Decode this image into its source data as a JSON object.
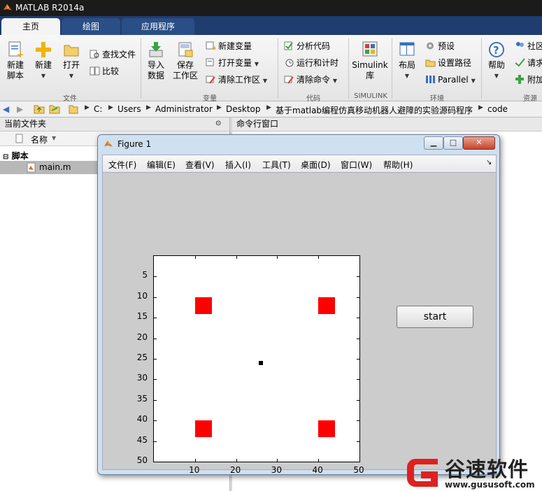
{
  "app": {
    "title": "MATLAB R2014a"
  },
  "tabs": [
    "主页",
    "绘图",
    "应用程序"
  ],
  "ribbon": {
    "file_group": "文件",
    "new_script": [
      "新建",
      "脚本"
    ],
    "new": "新建",
    "open": "打开",
    "find_files": "查找文件",
    "compare": "比较",
    "variable_group": "变量",
    "import_data": [
      "导入",
      "数据"
    ],
    "save_workspace": [
      "保存",
      "工作区"
    ],
    "new_variable": "新建变量",
    "open_variable": "打开变量",
    "clear_workspace": "清除工作区",
    "code_group": "代码",
    "analyze_code": "分析代码",
    "run_and_time": "运行和计时",
    "clear_commands": "清除命令",
    "simulink_group": "SIMULINK",
    "simulink_library": [
      "Simulink",
      "库"
    ],
    "environment_group": "环境",
    "layout": "布局",
    "preferences": "预设",
    "set_path": "设置路径",
    "parallel": "Parallel",
    "resources_group": "资源",
    "help": "帮助",
    "community": "社区",
    "request_support": "请求",
    "addons": "附加"
  },
  "address": [
    "C:",
    "Users",
    "Administrator",
    "Desktop",
    "基于matlab编程仿真移动机器人避障的实验源码程序",
    "code"
  ],
  "current_folder": {
    "title": "当前文件夹",
    "column_name": "名称",
    "group": "脚本",
    "file": "main.m"
  },
  "command_window": {
    "title": "命令行窗口"
  },
  "figure": {
    "title": "Figure 1",
    "menu": [
      "文件(F)",
      "编辑(E)",
      "查看(V)",
      "插入(I)",
      "工具(T)",
      "桌面(D)",
      "窗口(W)",
      "帮助(H)"
    ],
    "start_button": "start"
  },
  "chart_data": {
    "type": "scatter",
    "xlim": [
      0,
      50
    ],
    "ylim": [
      0,
      50
    ],
    "y_reversed": true,
    "xticks": [
      10,
      20,
      30,
      40,
      50
    ],
    "yticks": [
      5,
      10,
      15,
      20,
      25,
      30,
      35,
      40,
      45,
      50
    ],
    "series": [
      {
        "name": "",
        "marker": "square",
        "color": "#ff0000",
        "points": [
          [
            12,
            12
          ],
          [
            42,
            12
          ],
          [
            12,
            42
          ],
          [
            42,
            42
          ]
        ]
      },
      {
        "name": "",
        "marker": "point",
        "color": "#000000",
        "points": [
          [
            26,
            26
          ]
        ]
      }
    ]
  },
  "watermark": {
    "brand": "谷速软件",
    "url": "www.gususoft.com"
  }
}
